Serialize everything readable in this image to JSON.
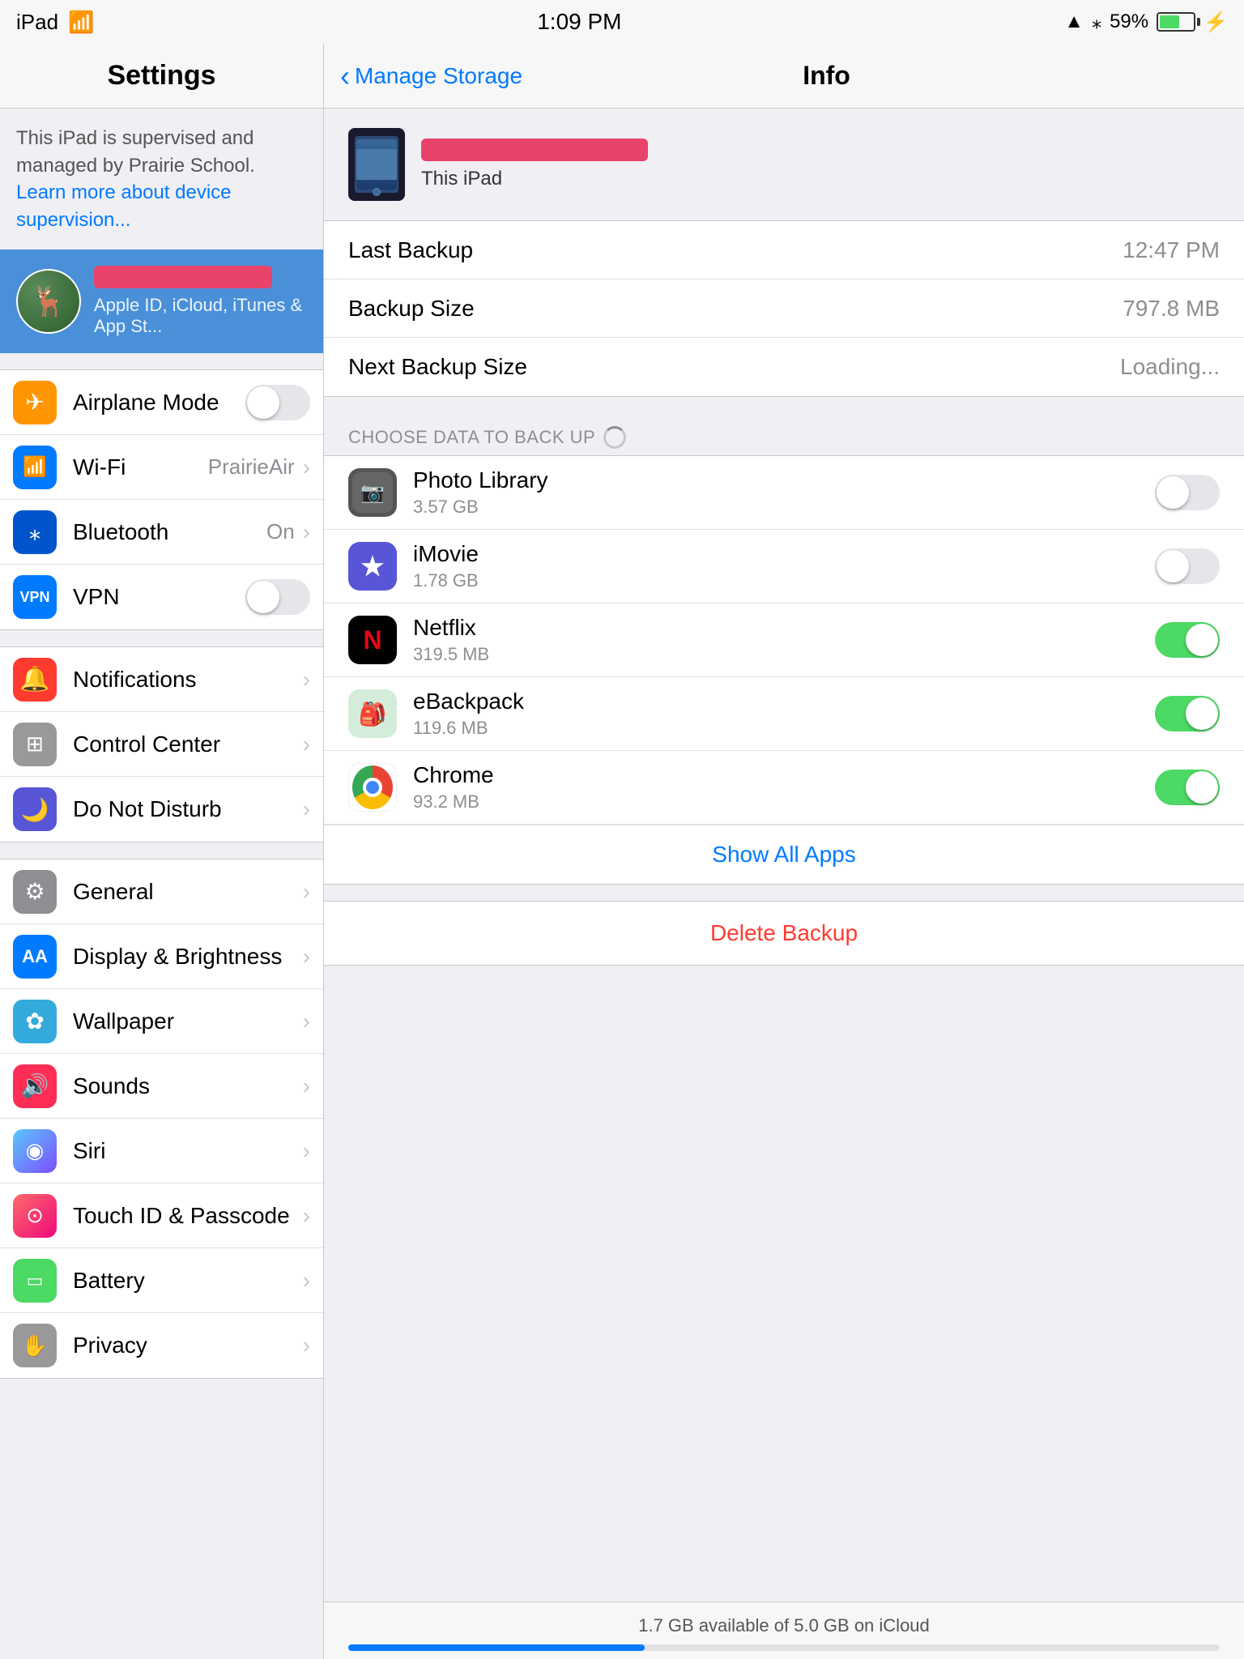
{
  "statusBar": {
    "device": "iPad",
    "wifi": "wifi",
    "time": "1:09 PM",
    "location": "▲",
    "bluetooth": "bluetooth",
    "battery_pct": "59%"
  },
  "settings": {
    "title": "Settings",
    "supervision_text": "This iPad is supervised and managed by Prairie School.",
    "supervision_link": "Learn more about device supervision...",
    "profile": {
      "subtitle": "Apple ID, iCloud, iTunes & App St..."
    },
    "items_group1": [
      {
        "id": "airplane-mode",
        "label": "Airplane Mode",
        "icon": "✈",
        "icon_class": "icon-orange",
        "control": "toggle-off"
      },
      {
        "id": "wifi",
        "label": "Wi-Fi",
        "icon": "wifi",
        "icon_class": "icon-blue",
        "value": "PrairieAir"
      },
      {
        "id": "bluetooth",
        "label": "Bluetooth",
        "icon": "bluetooth",
        "icon_class": "icon-blue-dark",
        "value": "On"
      },
      {
        "id": "vpn",
        "label": "VPN",
        "icon": "VPN",
        "icon_class": "icon-blue-dark",
        "control": "toggle-off"
      }
    ],
    "items_group2": [
      {
        "id": "notifications",
        "label": "Notifications",
        "icon": "🔲",
        "icon_class": "icon-red"
      },
      {
        "id": "control-center",
        "label": "Control Center",
        "icon": "⊞",
        "icon_class": "icon-gray2"
      },
      {
        "id": "do-not-disturb",
        "label": "Do Not Disturb",
        "icon": "🌙",
        "icon_class": "icon-purple"
      }
    ],
    "items_group3": [
      {
        "id": "general",
        "label": "General",
        "icon": "⚙",
        "icon_class": "icon-gear"
      },
      {
        "id": "display-brightness",
        "label": "Display & Brightness",
        "icon": "AA",
        "icon_class": "icon-blue"
      },
      {
        "id": "wallpaper",
        "label": "Wallpaper",
        "icon": "✿",
        "icon_class": "icon-light-blue"
      },
      {
        "id": "sounds",
        "label": "Sounds",
        "icon": "🔊",
        "icon_class": "icon-pink"
      },
      {
        "id": "siri",
        "label": "Siri",
        "icon": "◉",
        "icon_class": "icon-gradient-blue"
      },
      {
        "id": "touch-id",
        "label": "Touch ID & Passcode",
        "icon": "⊙",
        "icon_class": "icon-gradient-red"
      },
      {
        "id": "battery",
        "label": "Battery",
        "icon": "▭",
        "icon_class": "icon-green"
      },
      {
        "id": "privacy",
        "label": "Privacy",
        "icon": "✋",
        "icon_class": "icon-gray2"
      }
    ]
  },
  "info": {
    "back_label": "Manage Storage",
    "title": "Info",
    "device_subtitle": "This iPad",
    "backup": {
      "last_backup_label": "Last Backup",
      "last_backup_value": "12:47 PM",
      "backup_size_label": "Backup Size",
      "backup_size_value": "797.8 MB",
      "next_backup_label": "Next Backup Size",
      "next_backup_value": "Loading..."
    },
    "section_header": "CHOOSE DATA TO BACK UP",
    "apps": [
      {
        "id": "photo-library",
        "name": "Photo Library",
        "size": "3.57 GB",
        "enabled": false,
        "icon": "photo"
      },
      {
        "id": "imovie",
        "name": "iMovie",
        "size": "1.78 GB",
        "enabled": false,
        "icon": "imovie"
      },
      {
        "id": "netflix",
        "name": "Netflix",
        "size": "319.5 MB",
        "enabled": true,
        "icon": "netflix"
      },
      {
        "id": "ebackpack",
        "name": "eBackpack",
        "size": "119.6 MB",
        "enabled": true,
        "icon": "ebackpack"
      },
      {
        "id": "chrome",
        "name": "Chrome",
        "size": "93.2 MB",
        "enabled": true,
        "icon": "chrome"
      }
    ],
    "show_all_label": "Show All Apps",
    "delete_label": "Delete Backup",
    "storage_footer": "1.7 GB available of 5.0 GB on iCloud",
    "storage_pct": 34
  }
}
